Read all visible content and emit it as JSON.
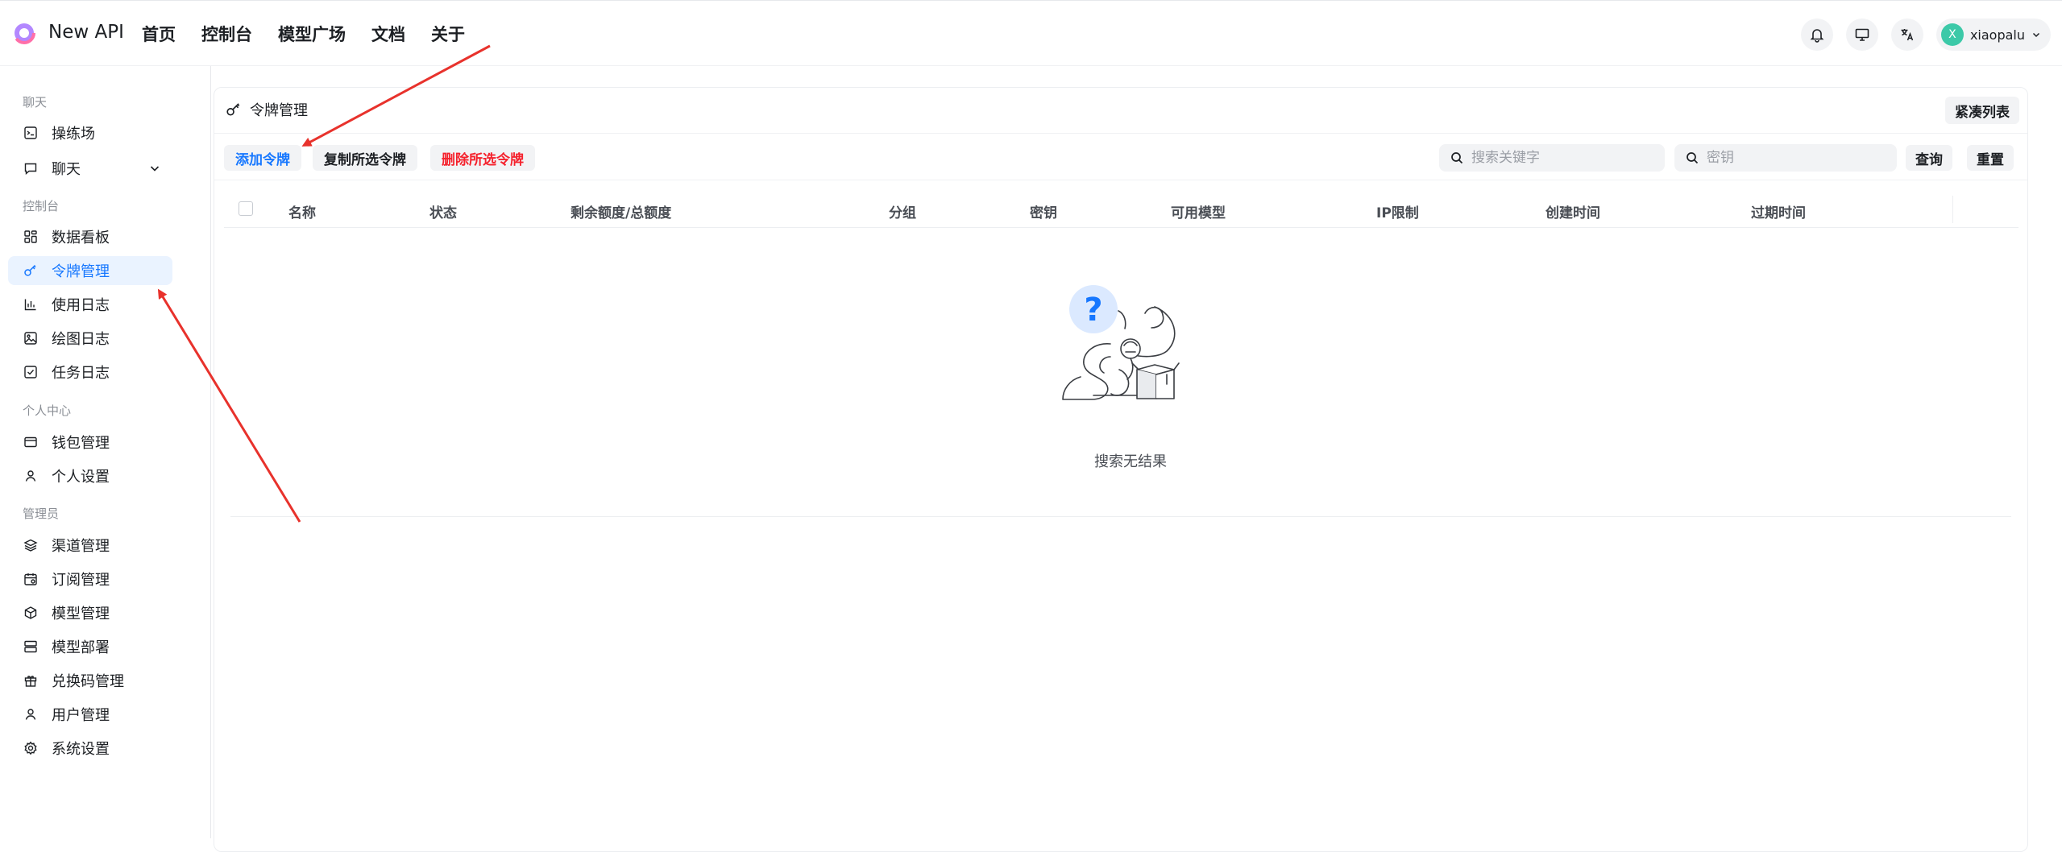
{
  "header": {
    "brand": "New API",
    "nav": [
      "首页",
      "控制台",
      "模型广场",
      "文档",
      "关于"
    ],
    "user": {
      "avatar_letter": "X",
      "name": "xiaopalu"
    }
  },
  "sidebar": {
    "sections": [
      {
        "title": "聊天",
        "items": [
          {
            "label": "操练场",
            "icon": "playground-icon"
          },
          {
            "label": "聊天",
            "icon": "chat-icon",
            "expandable": true
          }
        ]
      },
      {
        "title": "控制台",
        "items": [
          {
            "label": "数据看板",
            "icon": "dashboard-icon"
          },
          {
            "label": "令牌管理",
            "icon": "key-icon",
            "active": true
          },
          {
            "label": "使用日志",
            "icon": "bar-chart-icon"
          },
          {
            "label": "绘图日志",
            "icon": "image-icon"
          },
          {
            "label": "任务日志",
            "icon": "task-check-icon"
          }
        ]
      },
      {
        "title": "个人中心",
        "items": [
          {
            "label": "钱包管理",
            "icon": "wallet-icon"
          },
          {
            "label": "个人设置",
            "icon": "user-icon"
          }
        ]
      },
      {
        "title": "管理员",
        "items": [
          {
            "label": "渠道管理",
            "icon": "layers-icon"
          },
          {
            "label": "订阅管理",
            "icon": "calendar-icon"
          },
          {
            "label": "模型管理",
            "icon": "cube-icon"
          },
          {
            "label": "模型部署",
            "icon": "server-icon"
          },
          {
            "label": "兑换码管理",
            "icon": "gift-icon"
          },
          {
            "label": "用户管理",
            "icon": "user-icon"
          },
          {
            "label": "系统设置",
            "icon": "settings-icon"
          }
        ]
      }
    ]
  },
  "main": {
    "title": "令牌管理",
    "compact_label": "紧凑列表",
    "toolbar": {
      "add_label": "添加令牌",
      "copy_label": "复制所选令牌",
      "delete_label": "删除所选令牌",
      "keyword_placeholder": "搜索关键字",
      "key_placeholder": "密钥",
      "query_label": "查询",
      "reset_label": "重置"
    },
    "columns": [
      "名称",
      "状态",
      "剩余额度/总额度",
      "分组",
      "密钥",
      "可用模型",
      "IP限制",
      "创建时间",
      "过期时间"
    ],
    "empty_text": "搜索无结果"
  },
  "colors": {
    "accent": "#1677ff",
    "danger": "#f5222d",
    "active_bg": "#eaf3ff",
    "annotation_arrow": "#e8322c"
  }
}
